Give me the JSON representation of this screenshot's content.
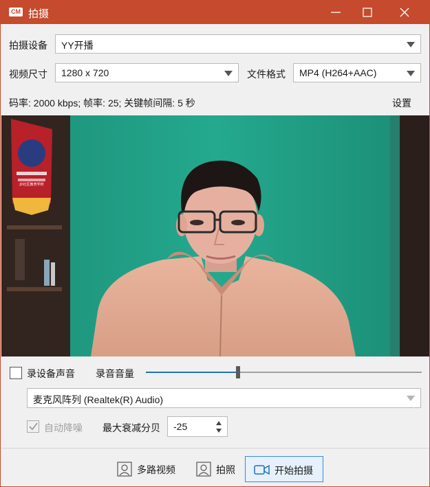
{
  "window": {
    "title": "拍摄",
    "logo_text": "CM",
    "accent_color": "#c54a2e"
  },
  "device": {
    "label": "拍摄设备",
    "value": "YY开播"
  },
  "video_size": {
    "label": "视频尺寸",
    "value": "1280 x 720"
  },
  "file_format": {
    "label": "文件格式",
    "value": "MP4 (H264+AAC)"
  },
  "encoding_info": "码率: 2000 kbps; 帧率: 25; 关键帧间隔: 5 秒",
  "settings_label": "设置",
  "pennant_text": "JD社区教育学校",
  "audio": {
    "record_device_sound_label": "录设备声音",
    "record_device_sound_checked": false,
    "volume_label": "录音音量",
    "volume_level": 0.33,
    "microphone": "麦克风阵列 (Realtek(R) Audio)",
    "auto_denoise_label": "自动降噪",
    "auto_denoise_checked": true,
    "max_attenuation_label": "最大衰减分贝",
    "max_attenuation_value": "-25"
  },
  "buttons": {
    "multi_video": "多路视频",
    "photo": "拍照",
    "start_capture": "开始拍摄"
  }
}
